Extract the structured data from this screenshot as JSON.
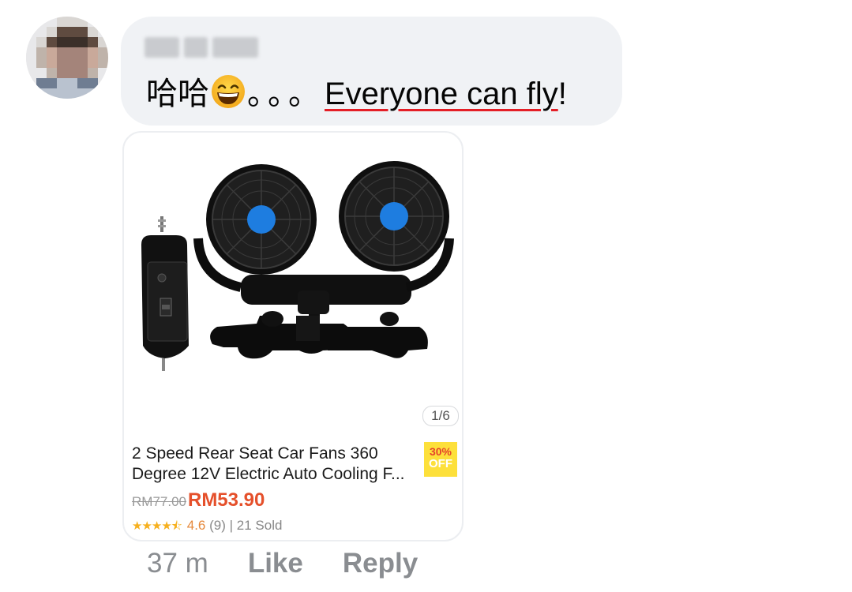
{
  "comment": {
    "author_name": "",
    "text_prefix": "哈哈",
    "emoji": "grinning-smiling-eyes-emoji",
    "text_dots": "。。。",
    "text_link": "Everyone can fly",
    "text_suffix": "!"
  },
  "product": {
    "image_icon": "dual-car-fan-image",
    "pager": "1/6",
    "title_line1": "2 Speed Rear Seat Car Fans 360",
    "title_line2": "Degree 12V Electric Auto Cooling F...",
    "discount_pct": "30%",
    "discount_off": "OFF",
    "old_price": "RM77.00",
    "new_price": "RM53.90",
    "rating_stars": 4.5,
    "rating_value": "4.6",
    "rating_count": "(9)",
    "sold": "| 21 Sold"
  },
  "actions": {
    "time": "37 m",
    "like": "Like",
    "reply": "Reply"
  },
  "colors": {
    "bubble_bg": "#f0f2f5",
    "price_accent": "#e5502b",
    "discount_bg": "#fde03b",
    "star": "#f6b01e",
    "action_text": "#8a8d91"
  }
}
